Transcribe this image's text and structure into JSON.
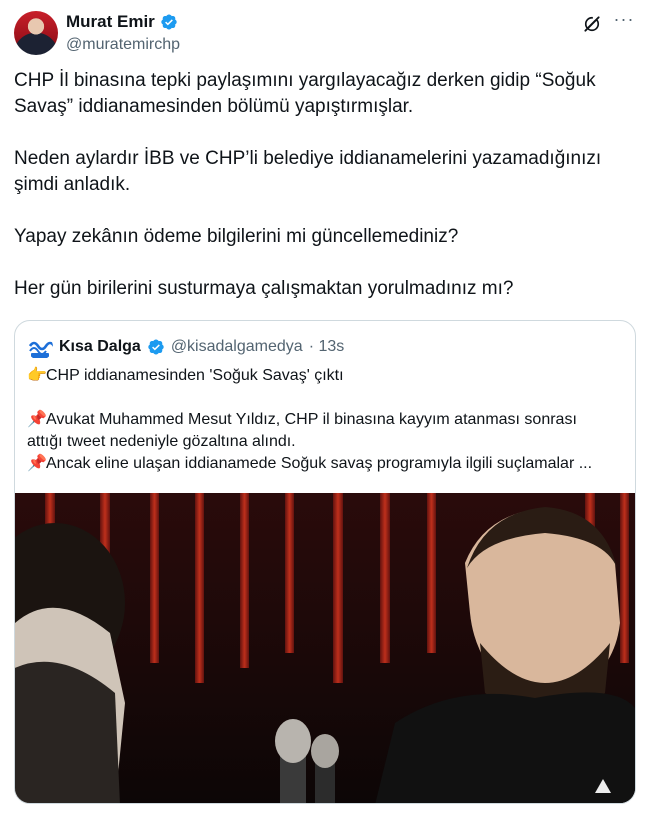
{
  "tweet": {
    "author_name": "Murat Emir",
    "author_handle": "@muratemirchp",
    "paragraphs": [
      "CHP İl binasına tepki paylaşımını yargılayacağız derken gidip “Soğuk Savaş” iddianamesinden bölümü yapıştırmışlar.",
      "Neden aylardır İBB ve CHP’li belediye iddianamelerini yazamadığınızı şimdi anladık.",
      "Yapay zekânın ödeme bilgilerini mi güncellemediniz?",
      "Her gün birilerini susturmaya çalışmaktan yorulmadınız mı?"
    ]
  },
  "quote": {
    "author_name": "Kısa Dalga",
    "author_handle": "@kisadalgamedya",
    "time": "· 13s",
    "lines": {
      "l1": "CHP iddianamesinden 'Soğuk Savaş' çıktı",
      "l2": "Avukat Muhammed Mesut Yıldız, CHP il binasına kayyım atanması sonrası",
      "l3": "attığı tweet nedeniyle gözaltına alındı.",
      "l4": "Ancak eline ulaşan iddianamede Soğuk savaş programıyla ilgili suçlamalar ..."
    },
    "emojis": {
      "point": "👉",
      "pin": "📌"
    }
  },
  "icons": {
    "verified": "verified-badge-icon",
    "grok": "grok-icon",
    "more": "more-options-icon"
  },
  "colors": {
    "verified": "#1d9bf0",
    "secondary_text": "#536471",
    "border": "#cfd9de"
  }
}
